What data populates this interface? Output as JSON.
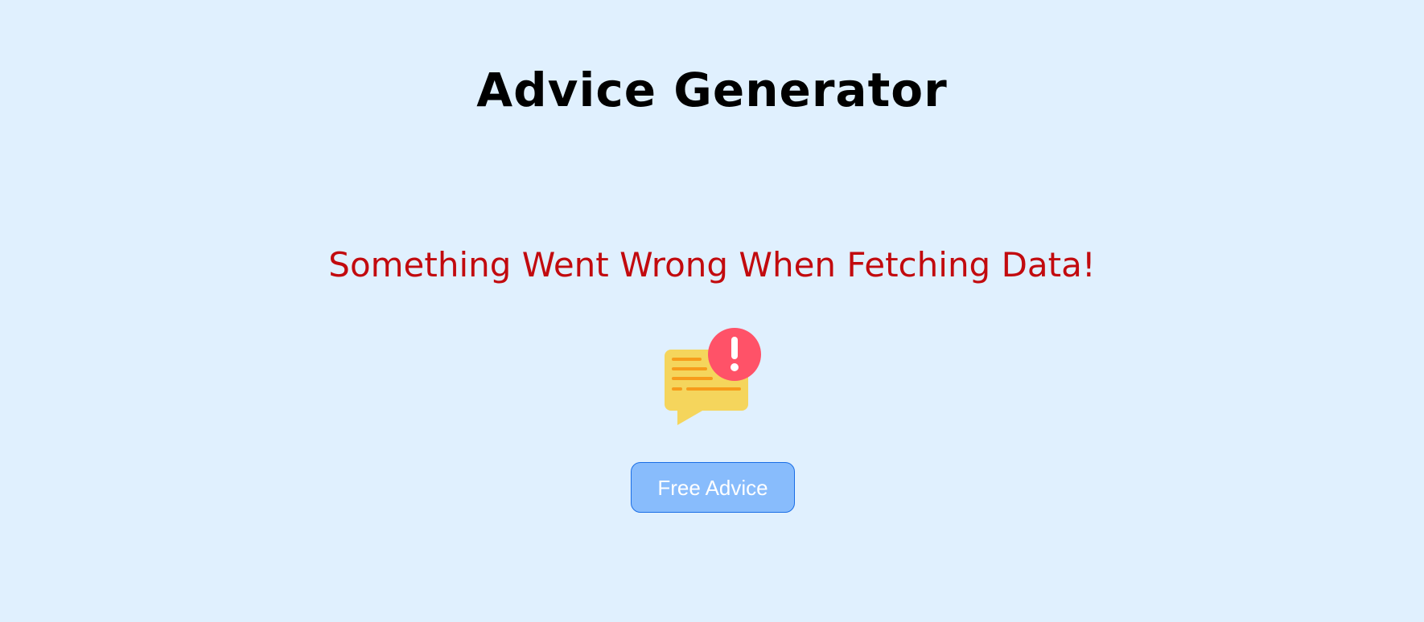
{
  "header": {
    "title": "Advice Generator"
  },
  "main": {
    "error_message": "Something Went Wrong When Fetching Data!",
    "error_icon": "chat-bubble-alert-icon",
    "button_label": "Free Advice"
  },
  "colors": {
    "background": "#e0f0fe",
    "title": "#000000",
    "error_text": "#c20a0e",
    "button_fill": "#88bcfc",
    "button_border": "#1a6ee6",
    "button_text": "#ffffff",
    "bubble": "#f5d55c",
    "bubble_lines": "#f79c1b",
    "alert_circle": "#ff5268"
  }
}
